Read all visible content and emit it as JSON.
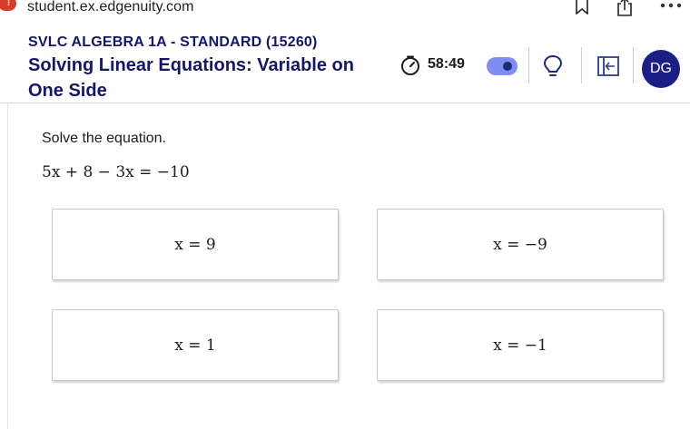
{
  "browser": {
    "url": "student.ex.edgenuity.com",
    "warning_badge": "!"
  },
  "header": {
    "course_name": "SVLC ALGEBRA 1A - STANDARD (15260)",
    "lesson_title": "Solving Linear Equations: Variable on One Side",
    "timer": "58:49",
    "avatar_initials": "DG"
  },
  "question": {
    "prompt": "Solve the equation.",
    "equation": "5x + 8 − 3x = −10"
  },
  "choices": [
    {
      "label": "x = 9"
    },
    {
      "label": "x = −9"
    },
    {
      "label": "x = 1"
    },
    {
      "label": "x = −1"
    }
  ],
  "colors": {
    "title_navy": "#14166b",
    "avatar_bg": "#1b1e85",
    "toggle_bg": "#7f8cf0",
    "warning_red": "#d93b2b"
  },
  "icons": [
    "warning-icon",
    "bookmark-icon",
    "share-icon",
    "more-icon",
    "timer-icon",
    "hint-lightbulb-icon",
    "exit-icon"
  ]
}
